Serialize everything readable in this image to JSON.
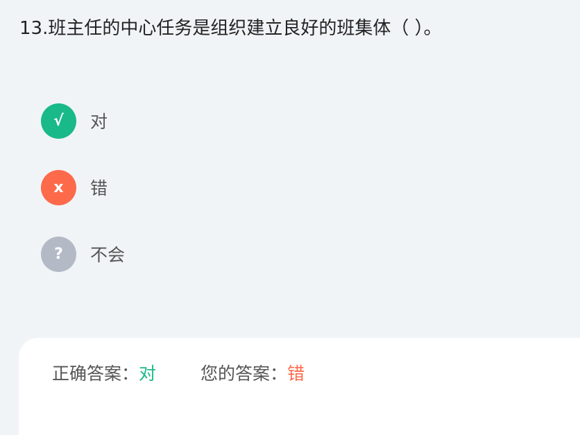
{
  "question": {
    "text": "13.班主任的中心任务是组织建立良好的班集体（ ）。"
  },
  "options": [
    {
      "icon": "check-icon",
      "symbol": "√",
      "label": "对",
      "color": "#19b989"
    },
    {
      "icon": "cross-icon",
      "symbol": "x",
      "label": "错",
      "color": "#fd6a4a"
    },
    {
      "icon": "question-icon",
      "symbol": "?",
      "label": "不会",
      "color": "#b3b9c5"
    }
  ],
  "result": {
    "correct_label": "正确答案：",
    "correct_value": "对",
    "correct_color": "#19b989",
    "yours_label": "您的答案：",
    "yours_value": "错",
    "yours_color": "#fd6a4a"
  },
  "colors": {
    "background": "#f1f4f7",
    "panel": "#ffffff"
  }
}
